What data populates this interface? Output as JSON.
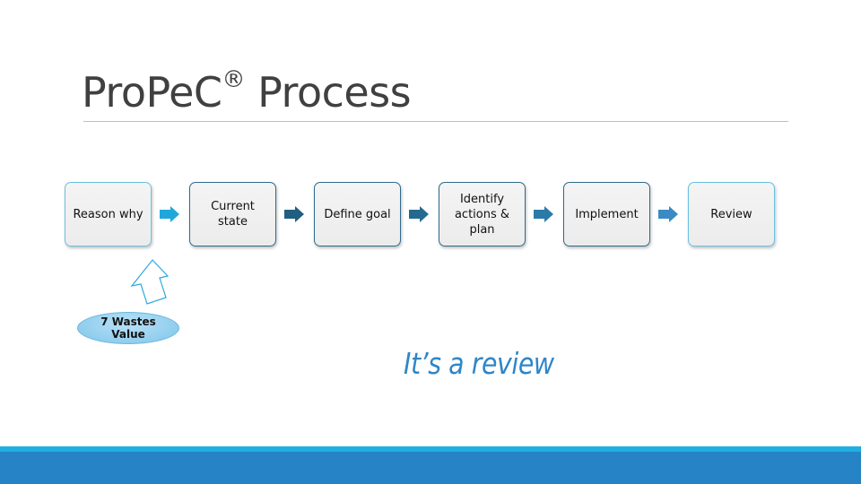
{
  "slide": {
    "title": "ProPeC",
    "title_mark": "®",
    "title_suffix": " Process",
    "steps": [
      {
        "label": "Reason why"
      },
      {
        "label": "Current\nstate"
      },
      {
        "label": "Define goal"
      },
      {
        "label": "Identify\nactions &\nplan"
      },
      {
        "label": "Implement"
      },
      {
        "label": "Review"
      }
    ],
    "input_bubble": "7 Wastes\nValue",
    "note": "It’s a review",
    "colors": {
      "accent": "#2683c6",
      "accent_light": "#1fb0e0",
      "arrow_first": "#1fa7dc",
      "arrow_dark": "#215f80",
      "arrow_mid": "#2b7aa8",
      "arrow_last": "#3a8ac4",
      "note_text": "#2e86c8"
    }
  }
}
